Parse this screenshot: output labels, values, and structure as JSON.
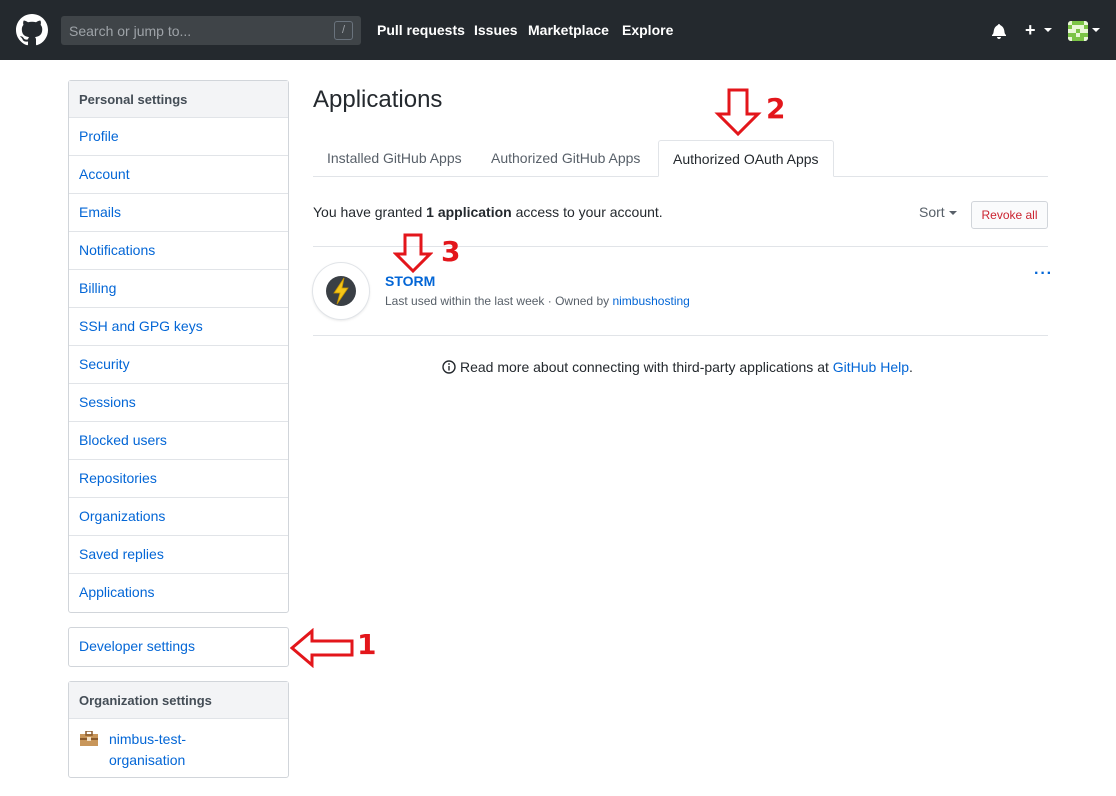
{
  "header": {
    "search_placeholder": "Search or jump to...",
    "slash_key": "/",
    "nav": [
      "Pull requests",
      "Issues",
      "Marketplace",
      "Explore"
    ],
    "plus": "+"
  },
  "sidebar": {
    "personal_heading": "Personal settings",
    "personal_items": [
      "Profile",
      "Account",
      "Emails",
      "Notifications",
      "Billing",
      "SSH and GPG keys",
      "Security",
      "Sessions",
      "Blocked users",
      "Repositories",
      "Organizations",
      "Saved replies",
      "Applications"
    ],
    "developer_settings": "Developer settings",
    "org_heading": "Organization settings",
    "org_name": "nimbus-test-organisation"
  },
  "main": {
    "title": "Applications",
    "tabs": [
      {
        "label": "Installed GitHub Apps",
        "active": false
      },
      {
        "label": "Authorized GitHub Apps",
        "active": false
      },
      {
        "label": "Authorized OAuth Apps",
        "active": true
      }
    ],
    "granted_prefix": "You have granted ",
    "granted_count": "1 application",
    "granted_suffix": " access to your account.",
    "sort_label": "Sort",
    "revoke_all": "Revoke all",
    "app": {
      "name": "STORM",
      "meta_prefix": "Last used within the last week · Owned by ",
      "owner": "nimbushosting",
      "menu": "···"
    },
    "help_prefix": "Read more about connecting with third-party applications at ",
    "help_link": "GitHub Help",
    "help_suffix": "."
  },
  "annotations": {
    "one": "1",
    "two": "2",
    "three": "3",
    "color": "#e3161b"
  },
  "colors": {
    "header_bg": "#24292e",
    "link": "#0366d6",
    "danger": "#cb2431",
    "storm_yellow": "#f5c518"
  }
}
